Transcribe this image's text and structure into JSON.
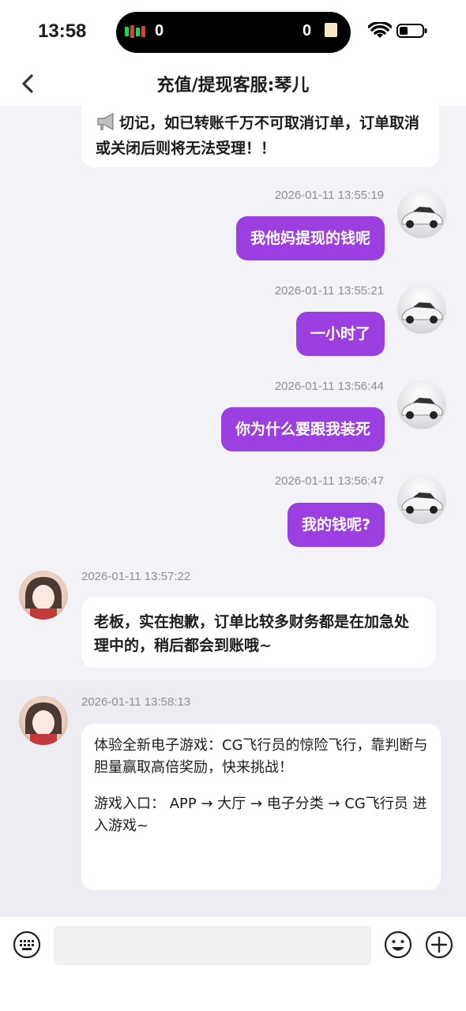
{
  "status_bar": {
    "time": "13:58",
    "island_left_count": "0",
    "island_right_count": "0"
  },
  "header": {
    "title": "充值/提现客服:琴儿"
  },
  "messages": [
    {
      "side": "in",
      "text": "切记，如已转账千万不可取消订单，订单取消或关闭后则将无法受理！！"
    },
    {
      "side": "out",
      "time": "2026-01-11 13:55:19",
      "text": "我他妈提现的钱呢"
    },
    {
      "side": "out",
      "time": "2026-01-11 13:55:21",
      "text": "一小时了"
    },
    {
      "side": "out",
      "time": "2026-01-11 13:56:44",
      "text": "你为什么要跟我装死"
    },
    {
      "side": "out",
      "time": "2026-01-11 13:56:47",
      "text": "我的钱呢?"
    },
    {
      "side": "in",
      "time": "2026-01-11 13:57:22",
      "text": "老板，实在抱歉，订单比较多财务都是在加急处理中的，稍后都会到账哦~"
    },
    {
      "side": "in",
      "time": "2026-01-11 13:58:13",
      "text_line1": "体验全新电子游戏：CG飞行员的惊险飞行，靠判断与胆量赢取高倍奖励，快来挑战！",
      "text_line2": "游戏入口： APP → 大厅 → 电子分类 → CG飞行员 进入游戏~"
    }
  ],
  "input": {
    "placeholder": ""
  },
  "colors": {
    "outgoing_bubble": "#9b3fe0",
    "incoming_bubble": "#ffffff",
    "chat_background": "#f2f2f7"
  }
}
